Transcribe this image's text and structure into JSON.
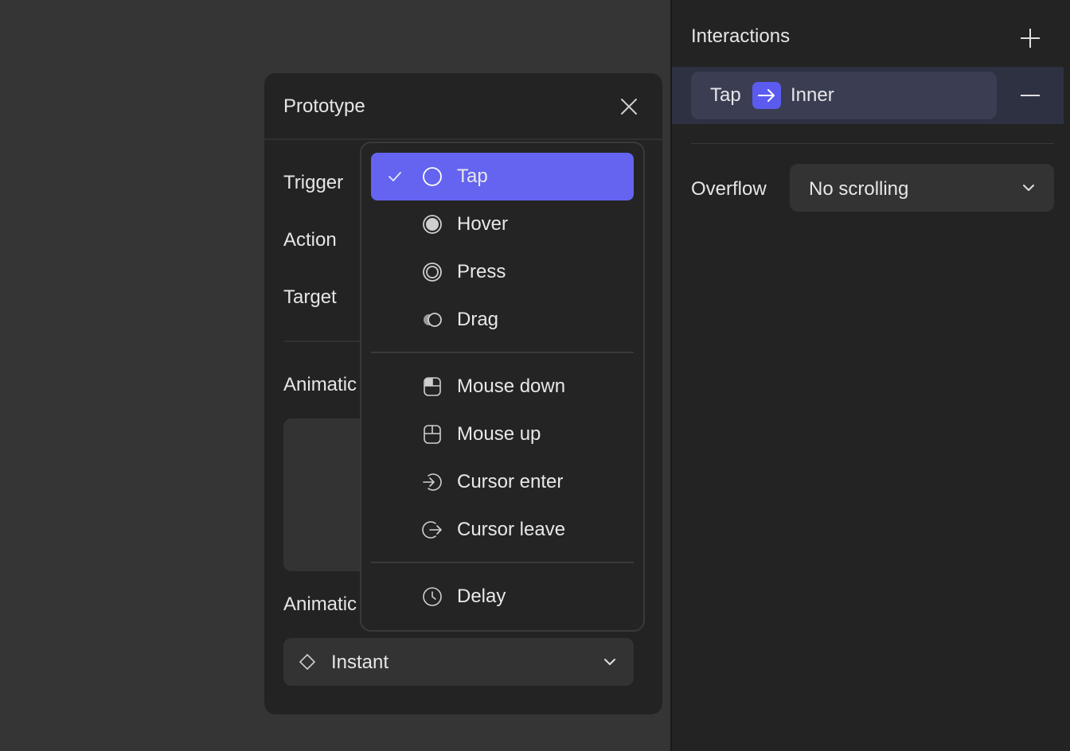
{
  "interactions_panel": {
    "title": "Interactions",
    "add_icon": "plus-icon",
    "item": {
      "trigger": "Tap",
      "arrow_icon": "arrow-right-icon",
      "target": "Inner"
    },
    "remove_icon": "minus-icon",
    "overflow_label": "Overflow",
    "overflow_value": "No scrolling"
  },
  "dialog": {
    "title": "Prototype",
    "close_icon": "close-icon",
    "labels": {
      "trigger": "Trigger",
      "action": "Action",
      "target": "Target",
      "animation1": "Animatic",
      "animation2": "Animatic"
    },
    "animation_select": {
      "icon": "diamond-icon",
      "value": "Instant"
    }
  },
  "trigger_menu": {
    "selected": "Tap",
    "groups": [
      [
        {
          "label": "Tap",
          "icon": "circle-outline-icon"
        },
        {
          "label": "Hover",
          "icon": "circle-filled-icon"
        },
        {
          "label": "Press",
          "icon": "circle-ring-icon"
        },
        {
          "label": "Drag",
          "icon": "drag-circles-icon"
        }
      ],
      [
        {
          "label": "Mouse down",
          "icon": "mouse-down-icon"
        },
        {
          "label": "Mouse up",
          "icon": "mouse-up-icon"
        },
        {
          "label": "Cursor enter",
          "icon": "cursor-enter-icon"
        },
        {
          "label": "Cursor leave",
          "icon": "cursor-leave-icon"
        }
      ],
      [
        {
          "label": "Delay",
          "icon": "clock-icon"
        }
      ]
    ]
  },
  "colors": {
    "accent": "#6464f0",
    "background": "#232323",
    "canvas": "#353535"
  }
}
